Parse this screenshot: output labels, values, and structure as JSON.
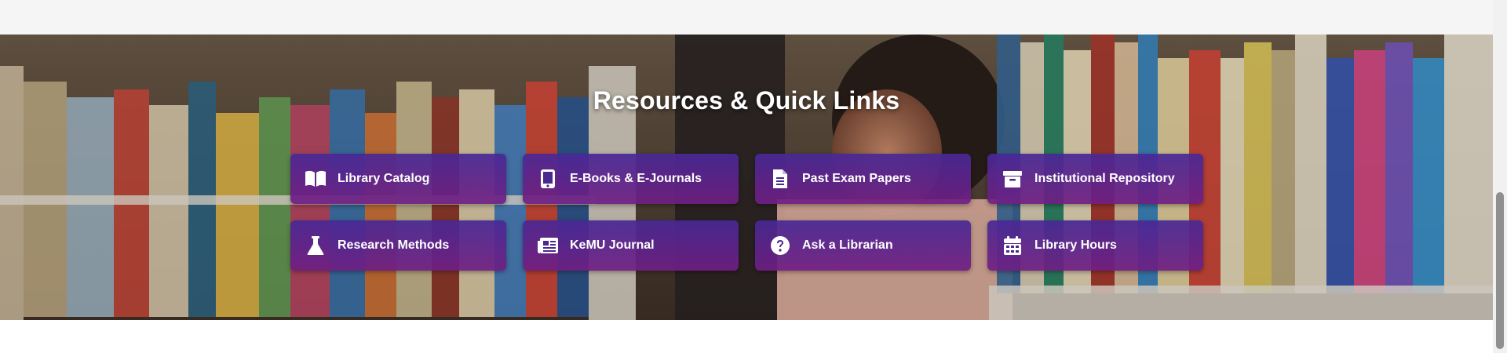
{
  "section": {
    "title": "Resources & Quick Links"
  },
  "links": [
    {
      "label": "Library Catalog",
      "icon": "book-open-icon"
    },
    {
      "label": "E-Books & E-Journals",
      "icon": "tablet-icon"
    },
    {
      "label": "Past Exam Papers",
      "icon": "file-text-icon"
    },
    {
      "label": "Institutional Repository",
      "icon": "archive-icon"
    },
    {
      "label": "Research Methods",
      "icon": "flask-icon"
    },
    {
      "label": "KeMU Journal",
      "icon": "newspaper-icon"
    },
    {
      "label": "Ask a Librarian",
      "icon": "question-circle-icon"
    },
    {
      "label": "Library Hours",
      "icon": "calendar-icon"
    }
  ],
  "colors": {
    "card_gradient_top": "#482896",
    "card_gradient_bottom": "#701e82",
    "title_text": "#ffffff"
  }
}
